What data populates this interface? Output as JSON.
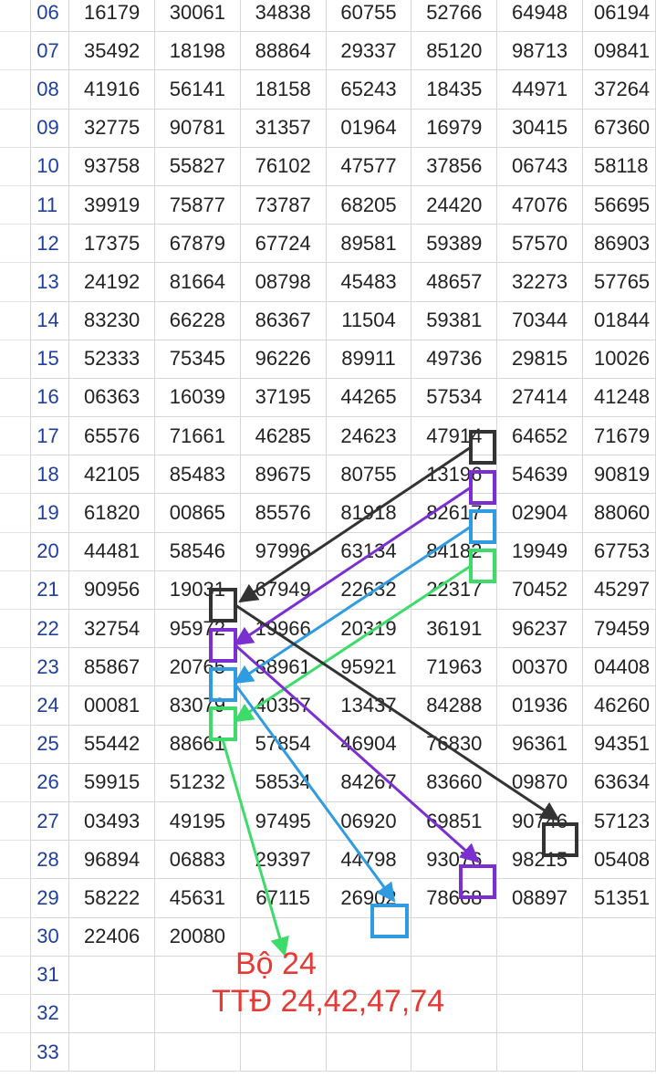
{
  "rows": [
    {
      "row": "06",
      "cells": [
        "16179",
        "30061",
        "34838",
        "60755",
        "52766",
        "64948",
        "06194"
      ]
    },
    {
      "row": "07",
      "cells": [
        "35492",
        "18198",
        "88864",
        "29337",
        "85120",
        "98713",
        "09841"
      ]
    },
    {
      "row": "08",
      "cells": [
        "41916",
        "56141",
        "18158",
        "65243",
        "18435",
        "44971",
        "37264"
      ]
    },
    {
      "row": "09",
      "cells": [
        "32775",
        "90781",
        "31357",
        "01964",
        "16979",
        "30415",
        "67360"
      ]
    },
    {
      "row": "10",
      "cells": [
        "93758",
        "55827",
        "76102",
        "47577",
        "37856",
        "06743",
        "58118"
      ]
    },
    {
      "row": "11",
      "cells": [
        "39919",
        "75877",
        "73787",
        "68205",
        "24420",
        "47076",
        "56695"
      ]
    },
    {
      "row": "12",
      "cells": [
        "17375",
        "67879",
        "67724",
        "89581",
        "59389",
        "57570",
        "86903"
      ]
    },
    {
      "row": "13",
      "cells": [
        "24192",
        "81664",
        "08798",
        "45483",
        "48657",
        "32273",
        "57765"
      ]
    },
    {
      "row": "14",
      "cells": [
        "83230",
        "66228",
        "86367",
        "11504",
        "59381",
        "70344",
        "01844"
      ]
    },
    {
      "row": "15",
      "cells": [
        "52333",
        "75345",
        "96226",
        "89911",
        "49736",
        "29815",
        "10026"
      ]
    },
    {
      "row": "16",
      "cells": [
        "06363",
        "16039",
        "37195",
        "44265",
        "57534",
        "27414",
        "41248"
      ]
    },
    {
      "row": "17",
      "cells": [
        "65576",
        "71661",
        "46285",
        "24623",
        "47914",
        "64652",
        "71679"
      ]
    },
    {
      "row": "18",
      "cells": [
        "42105",
        "85483",
        "89675",
        "80755",
        "13196",
        "54639",
        "90819"
      ]
    },
    {
      "row": "19",
      "cells": [
        "61820",
        "00865",
        "85576",
        "81918",
        "82617",
        "02904",
        "88060"
      ]
    },
    {
      "row": "20",
      "cells": [
        "44481",
        "58546",
        "97996",
        "63134",
        "84182",
        "19949",
        "67753"
      ]
    },
    {
      "row": "21",
      "cells": [
        "90956",
        "19031",
        "67949",
        "22632",
        "22317",
        "70452",
        "45297"
      ]
    },
    {
      "row": "22",
      "cells": [
        "32754",
        "95972",
        "19966",
        "20319",
        "36191",
        "96237",
        "79459"
      ]
    },
    {
      "row": "23",
      "cells": [
        "85867",
        "20765",
        "88961",
        "95921",
        "71963",
        "00370",
        "04408"
      ]
    },
    {
      "row": "24",
      "cells": [
        "00081",
        "83079",
        "40357",
        "13437",
        "84288",
        "01936",
        "46260"
      ]
    },
    {
      "row": "25",
      "cells": [
        "55442",
        "88661",
        "57854",
        "46904",
        "76830",
        "96361",
        "94351"
      ]
    },
    {
      "row": "26",
      "cells": [
        "59915",
        "51232",
        "58534",
        "84267",
        "83660",
        "09870",
        "63634"
      ]
    },
    {
      "row": "27",
      "cells": [
        "03493",
        "49195",
        "97495",
        "06920",
        "69851",
        "90746",
        "57123"
      ]
    },
    {
      "row": "28",
      "cells": [
        "96894",
        "06883",
        "29397",
        "44798",
        "93076",
        "98215",
        "05408"
      ]
    },
    {
      "row": "29",
      "cells": [
        "58222",
        "45631",
        "67115",
        "26902",
        "78668",
        "08897",
        "51351"
      ]
    },
    {
      "row": "30",
      "cells": [
        "22406",
        "20080",
        "",
        "",
        "",
        "",
        ""
      ]
    },
    {
      "row": "31",
      "cells": [
        "",
        "",
        "",
        "",
        "",
        "",
        ""
      ]
    },
    {
      "row": "32",
      "cells": [
        "",
        "",
        "",
        "",
        "",
        "",
        ""
      ]
    },
    {
      "row": "33",
      "cells": [
        "",
        "",
        "",
        "",
        "",
        "",
        ""
      ]
    }
  ],
  "annotation": {
    "line1": "Bộ 24",
    "line2": "TTĐ 24,42,47,74"
  },
  "colors": {
    "black": "#333333",
    "purple": "#7b2fd0",
    "blue": "#2f9be0",
    "green": "#3ddc6a",
    "note": "#e53935",
    "row_header": "#1f3f9a"
  }
}
